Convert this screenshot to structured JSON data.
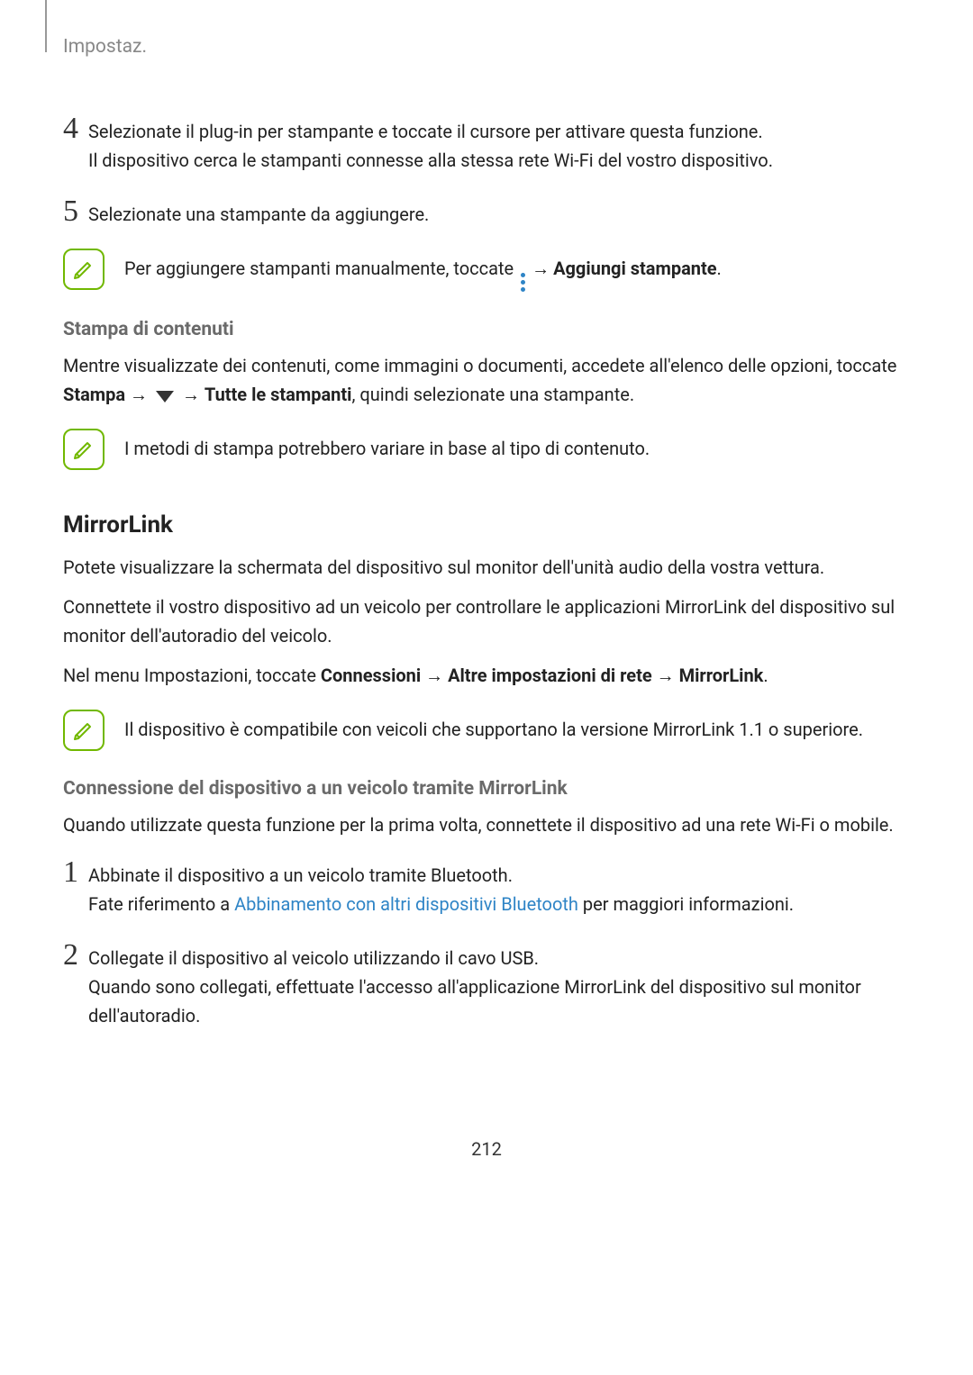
{
  "header": "Impostaz.",
  "step4": {
    "num": "4",
    "l1": "Selezionate il plug-in per stampante e toccate il cursore per attivare questa funzione.",
    "l2": "Il dispositivo cerca le stampanti connesse alla stessa rete Wi-Fi del vostro dispositivo."
  },
  "step5": {
    "num": "5",
    "l1": "Selezionate una stampante da aggiungere."
  },
  "note1": {
    "prefix": "Per aggiungere stampanti manualmente, toccate ",
    "arrow": "→",
    "bold": "Aggiungi stampante",
    "suffix": "."
  },
  "print": {
    "heading": "Stampa di contenuti",
    "p_prefix": "Mentre visualizzate dei contenuti, come immagini o documenti, accedete all'elenco delle opzioni, toccate ",
    "stampa": "Stampa",
    "arrow1": " → ",
    "arrow2": " → ",
    "tutte": "Tutte le stampanti",
    "suffix": ", quindi selezionate una stampante."
  },
  "note2": "I metodi di stampa potrebbero variare in base al tipo di contenuto.",
  "mirror": {
    "heading": "MirrorLink",
    "p1": "Potete visualizzare la schermata del dispositivo sul monitor dell'unità audio della vostra vettura.",
    "p2": "Connettete il vostro dispositivo ad un veicolo per controllare le applicazioni MirrorLink del dispositivo sul monitor dell'autoradio del veicolo.",
    "p3_prefix": "Nel menu Impostazioni, toccate ",
    "conn": "Connessioni",
    "arr": " → ",
    "altre": "Altre impostazioni di rete",
    "ml": "MirrorLink",
    "dot": "."
  },
  "note3": "Il dispositivo è compatibile con veicoli che supportano la versione MirrorLink 1.1 o superiore.",
  "connect": {
    "heading": "Connessione del dispositivo a un veicolo tramite MirrorLink",
    "intro": "Quando utilizzate questa funzione per la prima volta, connettete il dispositivo ad una rete Wi-Fi o mobile."
  },
  "mstep1": {
    "num": "1",
    "l1": "Abbinate il dispositivo a un veicolo tramite Bluetooth.",
    "l2a": "Fate riferimento a ",
    "link": "Abbinamento con altri dispositivi Bluetooth",
    "l2b": " per maggiori informazioni."
  },
  "mstep2": {
    "num": "2",
    "l1": "Collegate il dispositivo al veicolo utilizzando il cavo USB.",
    "l2": "Quando sono collegati, effettuate l'accesso all'applicazione MirrorLink del dispositivo sul monitor dell'autoradio."
  },
  "pageno": "212"
}
